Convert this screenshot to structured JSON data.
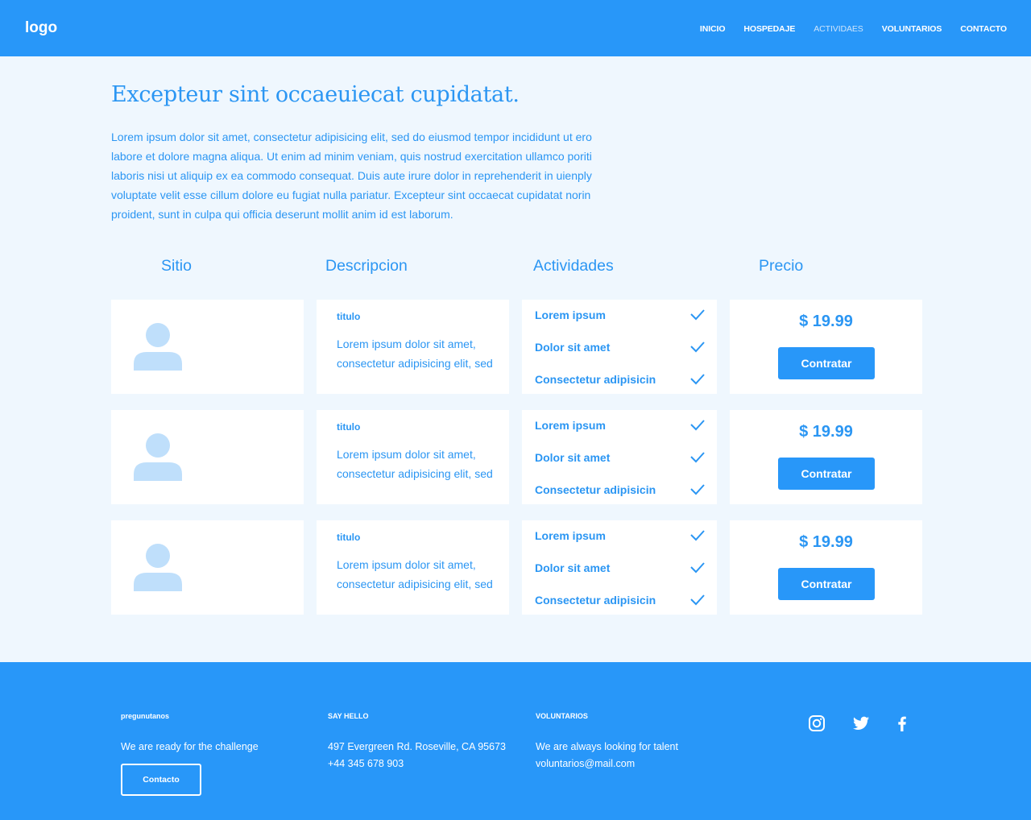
{
  "header": {
    "logo": "logo",
    "nav": [
      "INICIO",
      "HOSPEDAJE",
      "ACTIVIDAES",
      "VOLUNTARIOS",
      "CONTACTO"
    ]
  },
  "hero": {
    "title": "Excepteur sint occaeuiecat cupidatat.",
    "text": "Lorem ipsum dolor sit amet, consectetur adipisicing elit, sed do eiusmod tempor incididunt ut ero labore et dolore magna aliqua. Ut enim ad minim veniam, quis nostrud exercitation ullamco poriti laboris nisi ut aliquip ex ea commodo consequat. Duis aute irure dolor in reprehenderit in uienply voluptate velit esse cillum dolore eu fugiat nulla pariatur. Excepteur sint occaecat cupidatat norin proident, sunt in culpa qui officia deserunt mollit anim id est laborum."
  },
  "table": {
    "headers": [
      "Sitio",
      "Descripcion",
      "Actividades",
      "Precio"
    ],
    "rows": [
      {
        "titulo": "titulo",
        "desc": "Lorem ipsum dolor sit amet, consectetur adipisicing elit, sed",
        "activities": [
          "Lorem ipsum",
          "Dolor sit amet",
          "Consectetur adipisicin"
        ],
        "price": "$ 19.99",
        "button": "Contratar"
      },
      {
        "titulo": "titulo",
        "desc": "Lorem ipsum dolor sit amet, consectetur adipisicing elit, sed",
        "activities": [
          "Lorem ipsum",
          "Dolor sit amet",
          "Consectetur adipisicin"
        ],
        "price": "$ 19.99",
        "button": "Contratar"
      },
      {
        "titulo": "titulo",
        "desc": "Lorem ipsum dolor sit amet, consectetur adipisicing elit, sed",
        "activities": [
          "Lorem ipsum",
          "Dolor sit amet",
          "Consectetur adipisicin"
        ],
        "price": "$ 19.99",
        "button": "Contratar"
      }
    ]
  },
  "footer": {
    "col1": {
      "heading": "pregunutanos",
      "text": "We are ready for the challenge",
      "button": "Contacto"
    },
    "col2": {
      "heading": "SAY HELLO",
      "address": "497 Evergreen Rd. Roseville, CA 95673",
      "phone": "+44 345 678 903"
    },
    "col3": {
      "heading": "VOLUNTARIOS",
      "text": "We are always looking for talent",
      "email": "voluntarios@mail.com"
    },
    "social": [
      "instagram-icon",
      "twitter-icon",
      "facebook-icon"
    ]
  },
  "colors": {
    "primary": "#2897f9",
    "background": "#eff7fe",
    "card": "#ffffff",
    "avatar": "#bfdffb"
  }
}
